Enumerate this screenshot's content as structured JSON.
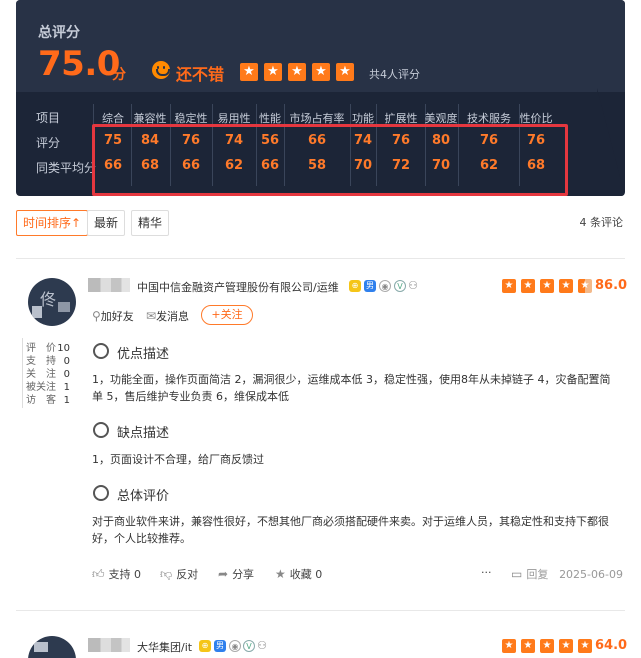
{
  "summary": {
    "title": "总评分",
    "score": "75.0",
    "unit": "分",
    "rating_word": "还不错",
    "stars": [
      1,
      1,
      1,
      1,
      0.5
    ],
    "count_text": "共4人评分"
  },
  "table": {
    "row_labels": [
      "项目",
      "评分",
      "同类平均分"
    ],
    "metrics": [
      {
        "name": "综合",
        "score": "75",
        "avg": "66"
      },
      {
        "name": "兼容性",
        "score": "84",
        "avg": "68"
      },
      {
        "name": "稳定性",
        "score": "76",
        "avg": "66"
      },
      {
        "name": "易用性",
        "score": "74",
        "avg": "62"
      },
      {
        "name": "性能",
        "score": "56",
        "avg": "66"
      },
      {
        "name": "市场占有率",
        "score": "66",
        "avg": "58"
      },
      {
        "name": "功能",
        "score": "74",
        "avg": "70"
      },
      {
        "name": "扩展性",
        "score": "76",
        "avg": "72"
      },
      {
        "name": "美观度",
        "score": "80",
        "avg": "70"
      },
      {
        "name": "技术服务",
        "score": "76",
        "avg": "62"
      },
      {
        "name": "性价比",
        "score": "76",
        "avg": "68"
      }
    ],
    "highlight_color": "#e5373f"
  },
  "filters": {
    "time_sort": "时间排序↑",
    "newest": "最新",
    "featured": "精华",
    "total": "4 条评论"
  },
  "review1": {
    "avatar_char": "佟",
    "company": "中国中信金融资产管理股份有限公司/运维",
    "badge_gold": "⊕",
    "badge_male": "男",
    "score": "86.0",
    "stars": [
      1,
      1,
      1,
      1,
      0.5
    ],
    "add_friend": "加好友",
    "send_msg": "发消息",
    "follow": "+关注",
    "stats": [
      {
        "label": "评　价",
        "value": "10"
      },
      {
        "label": "支　持",
        "value": "0"
      },
      {
        "label": "关　注",
        "value": "0"
      },
      {
        "label": "被关注",
        "value": "1"
      },
      {
        "label": "访　客",
        "value": "1"
      }
    ],
    "pros_title": "优点描述",
    "pros_text_1": "1，功能全面，操作页面简洁 2，漏洞很少，运维成本低 3，稳定性强，使用8年从未掉链子 4，灾备配置简",
    "pros_text_2": "单 5，售后维护专业负责 6，维保成本低",
    "cons_title": "缺点描述",
    "cons_text": "1，页面设计不合理，给厂商反馈过",
    "overall_title": "总体评价",
    "overall_text_1": "对于商业软件来讲，兼容性很好，不想其他厂商必须搭配硬件来卖。对于运维人员，其稳定性和支持下都很",
    "overall_text_2": "好，个人比较推荐。",
    "support": "支持 0",
    "oppose": "反对",
    "share": "分享",
    "collect": "收藏 0",
    "more": "···",
    "reply": "回复",
    "date": "2025-06-09"
  },
  "review2": {
    "company": "大华集团/it",
    "badge_male": "男",
    "score": "64.0",
    "stars": [
      1,
      1,
      1,
      1,
      0
    ]
  }
}
